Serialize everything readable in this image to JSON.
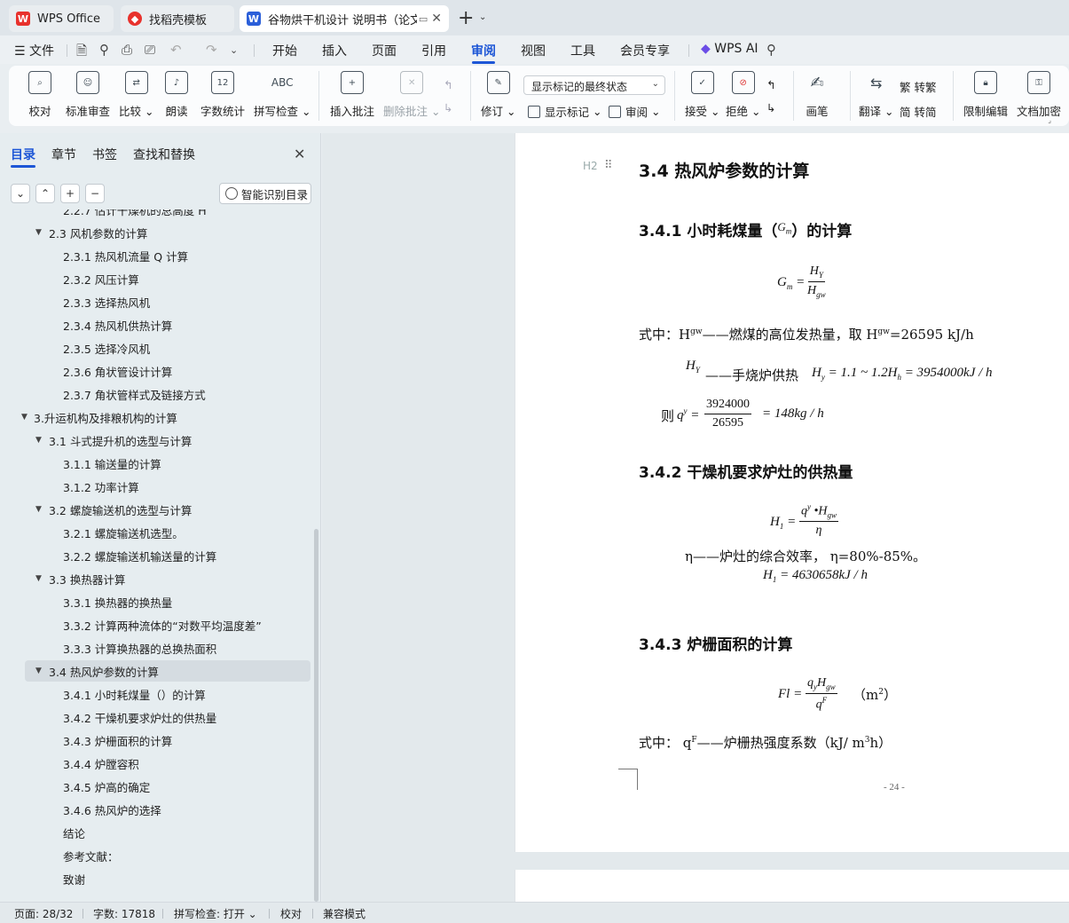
{
  "tabs": [
    {
      "label": "WPS Office",
      "icon": "wps-logo-icon",
      "color": "#e8322d"
    },
    {
      "label": "找稻壳模板",
      "icon": "docer-logo-icon",
      "color": "#e8322d"
    },
    {
      "label": "谷物烘干机设计 说明书（论文",
      "icon": "writer-logo-icon",
      "color": "#2b5fd9"
    }
  ],
  "menu": {
    "file": "文件",
    "items": [
      "开始",
      "插入",
      "页面",
      "引用",
      "审阅",
      "视图",
      "工具",
      "会员专享"
    ],
    "active": "审阅",
    "ai": "WPS AI"
  },
  "ribbon": {
    "proofread": "校对",
    "standard_review": "标准审查",
    "compare": "比较",
    "read_aloud": "朗读",
    "word_count": "字数统计",
    "word_count_icon_text": "12",
    "spell_check": "拼写检查",
    "spell_check_icon_text": "ABC",
    "insert_comment": "插入批注",
    "delete_comment": "删除批注",
    "track_changes": "修订",
    "markup_state": "显示标记的最终状态",
    "show_markup": "显示标记",
    "review": "审阅",
    "accept": "接受",
    "reject": "拒绝",
    "ink": "画笔",
    "translate": "翻译",
    "to_traditional": "转繁",
    "to_simplified": "转简",
    "restrict_edit": "限制编辑",
    "encrypt_doc": "文档加密"
  },
  "nav": {
    "tabs": [
      "目录",
      "章节",
      "书签",
      "查找和替换"
    ],
    "active_tab": "目录",
    "smart_toc": "智能识别目录",
    "toc": [
      {
        "label": "2.2.7 估计干燥机的总高度 H",
        "level": 3
      },
      {
        "label": "2.3 风机参数的计算",
        "level": 2,
        "expanded": true
      },
      {
        "label": "2.3.1 热风机流量 Q 计算",
        "level": 3
      },
      {
        "label": "2.3.2  风压计算",
        "level": 3
      },
      {
        "label": "2.3.3    选择热风机",
        "level": 3
      },
      {
        "label": "2.3.4  热风机供热计算",
        "level": 3
      },
      {
        "label": "2.3.5  选择冷风机",
        "level": 3
      },
      {
        "label": "2.3.6  角状管设计计算",
        "level": 3
      },
      {
        "label": "2.3.7 角状管样式及链接方式",
        "level": 3
      },
      {
        "label": "3.升运机构及排粮机构的计算",
        "level": 1,
        "expanded": true
      },
      {
        "label": "3.1 斗式提升机的选型与计算",
        "level": 2,
        "expanded": true
      },
      {
        "label": "3.1.1 输送量的计算",
        "level": 3
      },
      {
        "label": "3.1.2 功率计算",
        "level": 3
      },
      {
        "label": "3.2 螺旋输送机的选型与计算",
        "level": 2,
        "expanded": true
      },
      {
        "label": "3.2.1 螺旋输送机选型。",
        "level": 3
      },
      {
        "label": "3.2.2 螺旋输送机输送量的计算",
        "level": 3
      },
      {
        "label": "3.3 换热器计算",
        "level": 2,
        "expanded": true
      },
      {
        "label": "3.3.1  换热器的换热量",
        "level": 3
      },
      {
        "label": "3.3.2 计算两种流体的“对数平均温度差”",
        "level": 3
      },
      {
        "label": "3.3.3 计算换热器的总换热面积",
        "level": 3
      },
      {
        "label": "3.4 热风炉参数的计算",
        "level": 2,
        "expanded": true,
        "selected": true
      },
      {
        "label": "3.4.1 小时耗煤量（）的计算",
        "level": 3
      },
      {
        "label": "3.4.2 干燥机要求炉灶的供热量",
        "level": 3
      },
      {
        "label": "3.4.3  炉栅面积的计算",
        "level": 3
      },
      {
        "label": "3.4.4 炉膛容积",
        "level": 3
      },
      {
        "label": "3.4.5 炉高的确定",
        "level": 3
      },
      {
        "label": "3.4.6 热风炉的选择",
        "level": 3
      },
      {
        "label": "结论",
        "level": 3
      },
      {
        "label": "参考文献：",
        "level": 3
      },
      {
        "label": "致谢",
        "level": 3
      }
    ]
  },
  "doc": {
    "heading_marker": "H2",
    "h_34": "3.4 热风炉参数的计算",
    "h_341_pre": "3.4.1 小时耗煤量（",
    "h_341_post": "）的计算",
    "h_341_var": "G",
    "h_341_sub": "m",
    "f1_lhs": "G",
    "f1_lhs_sub": "m",
    "f1_num": "H",
    "f1_num_sub": "Y",
    "f1_den": "H",
    "f1_den_sub": "gw",
    "p1_a": "式中：H",
    "p1_sup": "gw",
    "p1_b": "——燃煤的高位发热量，取 H",
    "p1_c": "=26595 kJ/h",
    "p2_var": "H",
    "p2_sub": "Y",
    "p2_text": "——手烧炉供热",
    "p2_math": "= 1.1 ~ 1.2",
    "p2_end": "= 3954000kJ / h",
    "p3_then": "则",
    "p3_num": "3924000",
    "p3_den": "26595",
    "p3_res": "= 148kg / h",
    "h_342": "3.4.2 干燥机要求炉灶的供热量",
    "f2_num": "q",
    "f2_den": "η",
    "p4_text": "η——炉灶的综合效率，  η=80%-85%。",
    "f2b": "= 4630658kJ / h",
    "h_343": "3.4.3  炉栅面积的计算",
    "f3_lhs": "Fl =",
    "f3_unit": "（m",
    "f3_unit_sup": "2",
    "f3_unit_end": "）",
    "p5_a": "式中：   q",
    "p5_sup": "F",
    "p5_b": "——炉栅热强度系数（kJ/ m",
    "p5_sup2": "3",
    "p5_c": "h）",
    "page_number": "- 24 -"
  },
  "status": {
    "page": "页面: 28/32",
    "words": "字数: 17818",
    "spell": "拼写检查: 打开",
    "proof": "校对",
    "compat": "兼容模式"
  }
}
